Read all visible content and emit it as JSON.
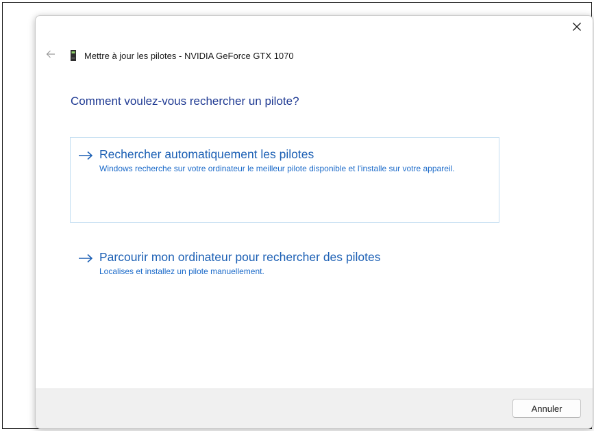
{
  "dialog": {
    "title": "Mettre à jour les pilotes - NVIDIA GeForce GTX 1070",
    "icons": {
      "close": "close-icon",
      "back": "back-arrow-icon",
      "device": "graphics-card-icon",
      "option_arrow": "arrow-right-icon"
    },
    "question": "Comment voulez-vous rechercher un pilote?",
    "options": [
      {
        "title": "Rechercher automatiquement les pilotes",
        "description": "Windows recherche sur votre ordinateur le meilleur pilote disponible et l'installe sur votre appareil."
      },
      {
        "title": "Parcourir mon ordinateur pour rechercher des pilotes",
        "description": "Localises et installez un pilote manuellement."
      }
    ],
    "cancel_label": "Annuler"
  },
  "colors": {
    "question_text": "#1f3a93",
    "link_title": "#1b5fb4",
    "link_description": "#1b6ac9",
    "focus_border": "#c2ddf1",
    "footer_background": "#f0f0f0"
  }
}
